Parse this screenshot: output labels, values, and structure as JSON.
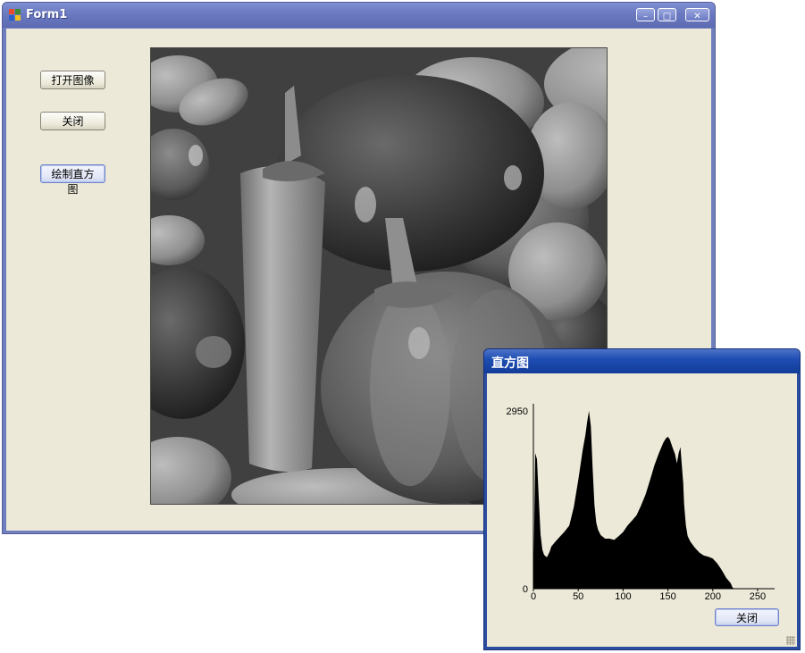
{
  "main_window": {
    "title": "Form1",
    "controls": {
      "minimize": "–",
      "maximize": "□",
      "close": "✕"
    },
    "buttons": {
      "open_image": "打开图像",
      "close": "关闭",
      "draw_histogram": "绘制直方图"
    }
  },
  "histogram_window": {
    "title": "直方图",
    "close_button": "关闭"
  },
  "chart_data": {
    "type": "area",
    "title": "",
    "xlabel": "",
    "ylabel": "",
    "xlim": [
      0,
      255
    ],
    "ylim": [
      0,
      2950
    ],
    "x_ticks": [
      "0",
      "50",
      "100",
      "150",
      "200",
      "250"
    ],
    "y_ticks": [
      "0",
      "2950"
    ],
    "series": [
      {
        "x": [
          0,
          2,
          4,
          6,
          8,
          10,
          12,
          15,
          18,
          20,
          25,
          30,
          35,
          40,
          45,
          50,
          55,
          58,
          60,
          62,
          64,
          66,
          68,
          70,
          72,
          75,
          80,
          85,
          90,
          95,
          100,
          105,
          110,
          115,
          120,
          125,
          130,
          135,
          140,
          145,
          148,
          150,
          152,
          155,
          158,
          160,
          162,
          164,
          165,
          167,
          168,
          170,
          172,
          175,
          180,
          185,
          190,
          195,
          200,
          205,
          210,
          215,
          220,
          222,
          224,
          225,
          255
        ],
        "values": [
          0,
          2250,
          2150,
          1500,
          900,
          650,
          560,
          520,
          610,
          700,
          790,
          870,
          950,
          1050,
          1350,
          1800,
          2300,
          2550,
          2770,
          2950,
          2700,
          2000,
          1400,
          1100,
          980,
          890,
          830,
          830,
          810,
          870,
          940,
          1050,
          1130,
          1220,
          1380,
          1560,
          1800,
          2050,
          2250,
          2430,
          2500,
          2520,
          2480,
          2350,
          2230,
          2080,
          2250,
          2350,
          2150,
          1750,
          1400,
          1050,
          870,
          780,
          680,
          600,
          550,
          530,
          500,
          420,
          310,
          180,
          90,
          20,
          5,
          0,
          0
        ]
      }
    ]
  }
}
